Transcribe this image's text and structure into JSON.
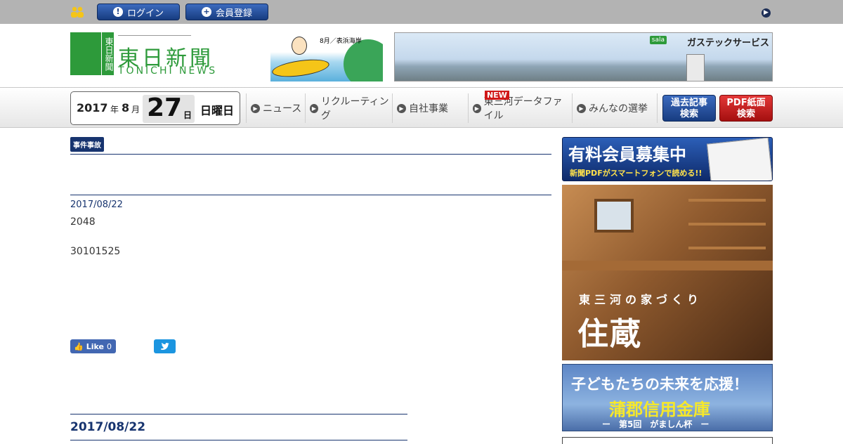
{
  "topbar": {
    "login_label": "ログイン",
    "register_label": "会員登録"
  },
  "logo": {
    "vertical": "東日新聞",
    "kanji": "東日新聞",
    "english": "TONICHI NEWS"
  },
  "ads": {
    "surf_caption": "8月／表浜海岸",
    "gas_brand": "sala",
    "gas_title": "ガステックサービス"
  },
  "date": {
    "year": "2017",
    "year_unit": "年",
    "month": "8",
    "month_unit": "月",
    "day": "27",
    "day_unit": "日",
    "weekday": "日曜日"
  },
  "nav": {
    "items": [
      "ニュース",
      "リクルーティング",
      "自社事業",
      "東三河データファイル",
      "みんなの選挙"
    ],
    "new_badge": "NEW",
    "archive_button": [
      "過去記事",
      "検索"
    ],
    "pdf_button": [
      "PDF紙面",
      "検索"
    ]
  },
  "article": {
    "category": "事件事故",
    "date": "2017/08/22",
    "paragraph1": "2048",
    "paragraph2": "30101525"
  },
  "social": {
    "like_label": "Like",
    "like_count": "0"
  },
  "archive": {
    "date_heading": "2017/08/22"
  },
  "sidebar": {
    "member_title": "有料会員募集中",
    "member_sub": "新聞PDFがスマートフォンで読める!!",
    "house_line1": "東三河の家づくり",
    "house_line2": "住蔵",
    "bank_line1": "子どもたちの未来を応援！",
    "bank_line2": "蒲郡信用金庫",
    "bank_line3": "ー　第5回　がましん杯　ー"
  },
  "colors": {
    "topbar": "#b3b3b3",
    "navy": "#17346f",
    "logo_green": "#2d9a3a",
    "pdf_red": "#c01818",
    "like_blue": "#4267b2",
    "tweet_blue": "#1b95e0"
  }
}
